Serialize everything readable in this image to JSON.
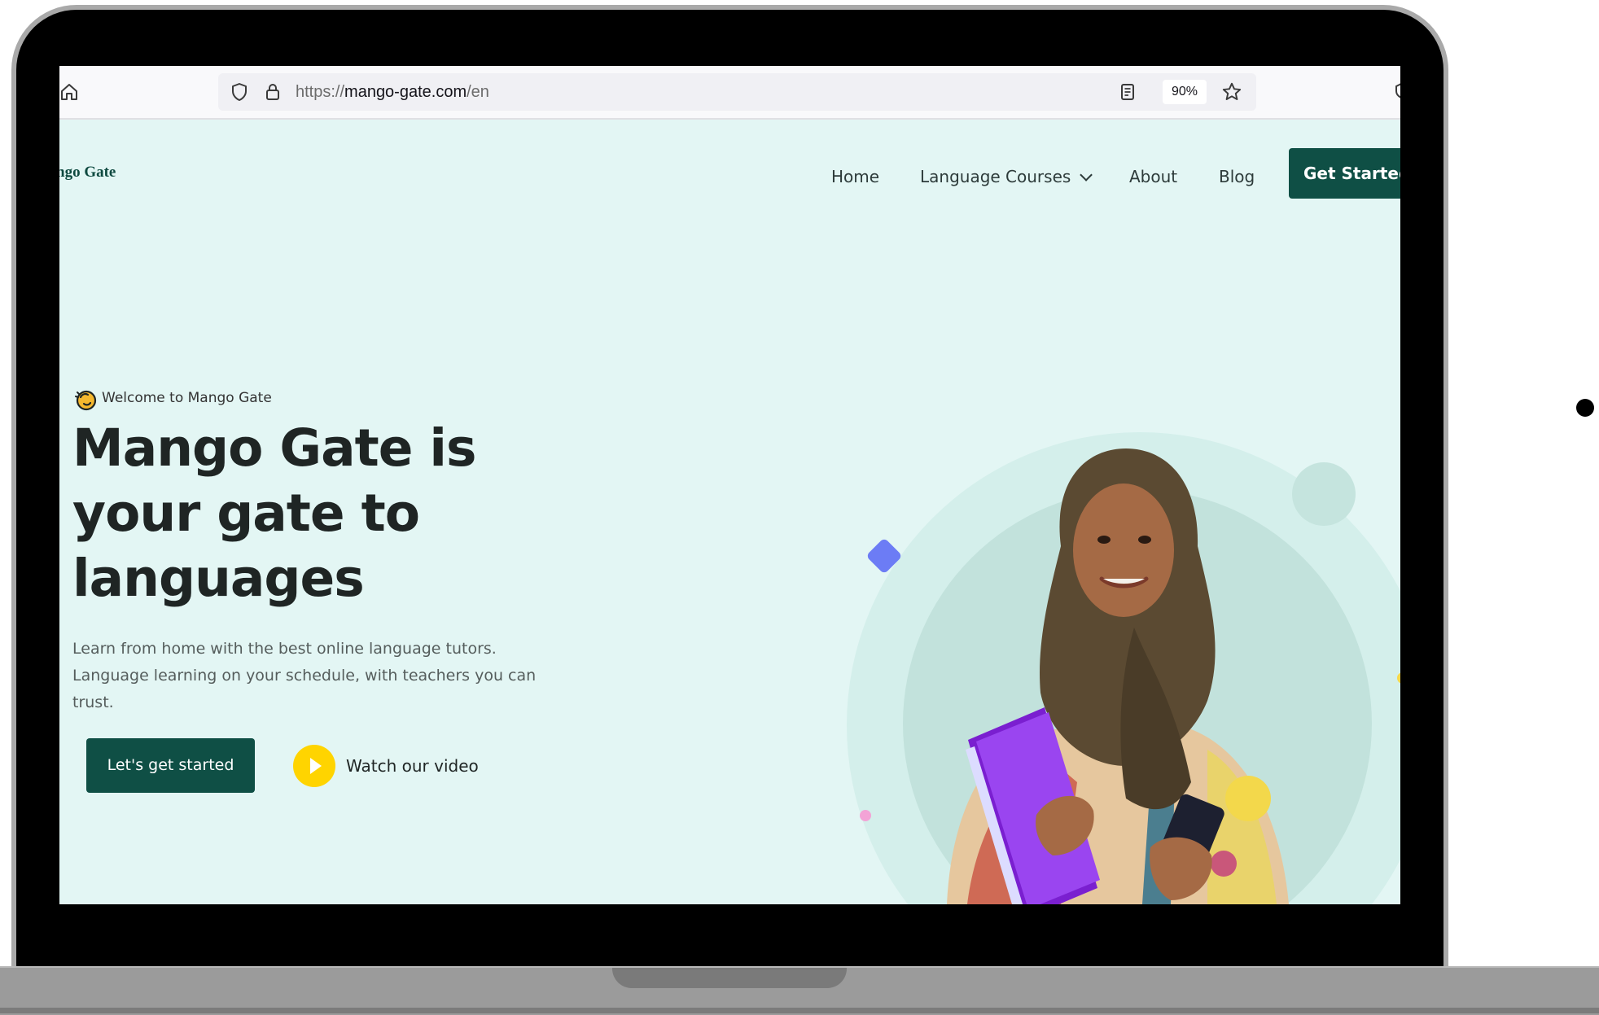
{
  "browser": {
    "url_prefix": "https://",
    "url_domain": "mango-gate.com",
    "url_path": "/en",
    "zoom": "90%"
  },
  "site": {
    "logo_text": "ngo Gate",
    "nav": {
      "home": "Home",
      "language_courses": "Language Courses",
      "about": "About",
      "blog": "Blog"
    },
    "get_started": "Get Started"
  },
  "hero": {
    "welcome": "Welcome to Mango Gate",
    "title": "Mango Gate is your gate to languages",
    "description": "Learn from home with the best online language tutors. Language learning on your schedule, with teachers you can trust.",
    "cta_label": "Let's get started",
    "video_label": "Watch our video"
  },
  "colors": {
    "brand_green": "#0f4f45",
    "page_bg": "#e3f6f4",
    "accent_yellow": "#ffd400",
    "accent_purple": "#8b2fe6",
    "accent_blue": "#6c7cf5"
  },
  "icons": {
    "browser_home": "home-icon",
    "shield": "shield-icon",
    "lock": "lock-icon",
    "reader": "reader-mode-icon",
    "bookmark": "star-icon",
    "welcome": "waving-hand-icon",
    "video": "play-icon"
  }
}
